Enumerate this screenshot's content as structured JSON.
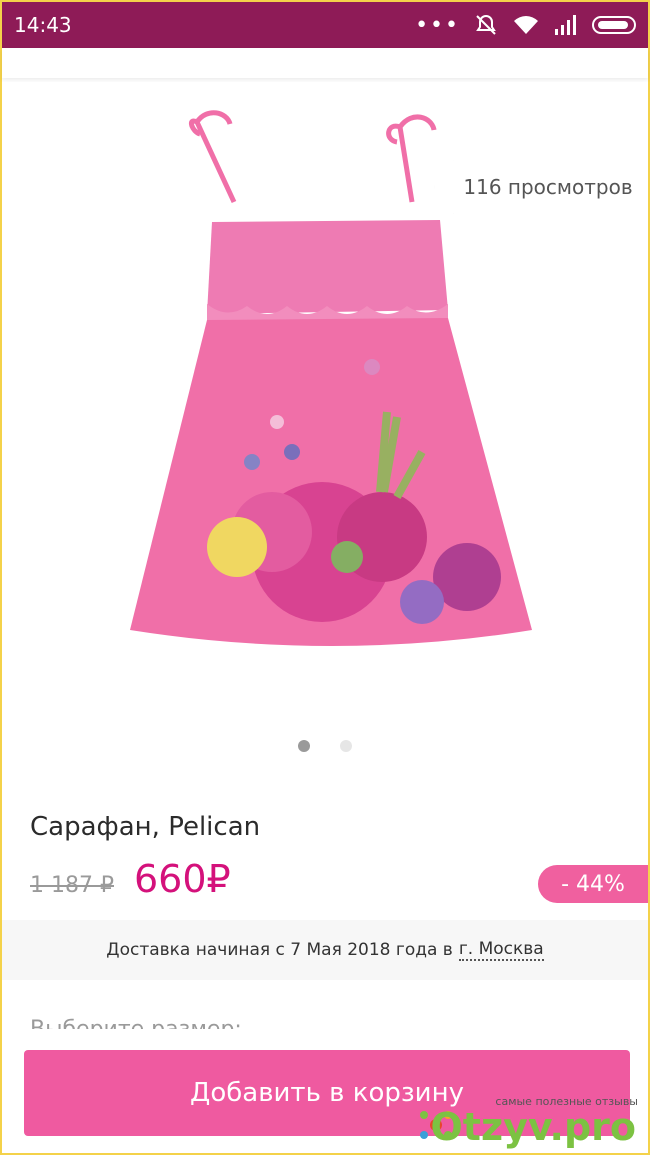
{
  "status_bar": {
    "time": "14:43",
    "icons": [
      "more-dots-icon",
      "mute-icon",
      "wifi-icon",
      "signal-icon",
      "battery-icon"
    ]
  },
  "product": {
    "views_tag": "116 просмотров",
    "title": "Сарафан, Pelican",
    "old_price": "1 187 ₽",
    "new_price": "660₽",
    "discount": "- 44%",
    "image_dots": {
      "count": 2,
      "active_index": 0
    }
  },
  "delivery": {
    "text": "Доставка начиная с 7 Мая 2018 года в",
    "city": "г. Москва"
  },
  "size_selector": {
    "label": "Выберите размер:"
  },
  "cart": {
    "button_label": "Добавить в корзину"
  },
  "watermark": {
    "tagline": "самые полезные отзывы",
    "brand": "Otzyv.pro"
  },
  "colors": {
    "status_bar": "#8e1b57",
    "accent_pink": "#d4117b",
    "button_pink": "#ef5aa0",
    "badge_pink": "#f0609f",
    "dress_pink": "#f06fa8"
  }
}
